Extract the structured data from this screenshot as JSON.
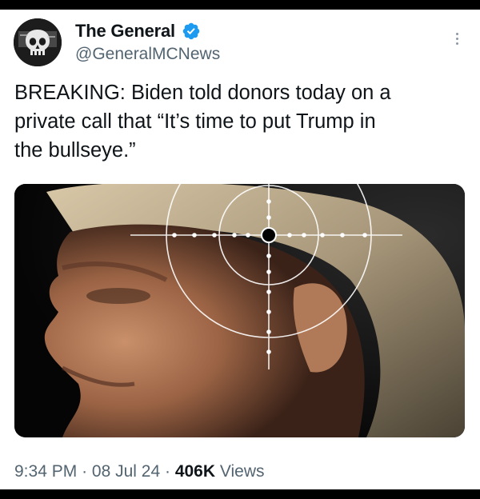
{
  "tweet": {
    "author": {
      "display_name": "The General",
      "handle": "@GeneralMCNews",
      "verified": true,
      "avatar_icon": "skull-emblem-avatar",
      "verified_color": "#1d9bf0"
    },
    "more_icon": "more-options-icon",
    "text": "BREAKING: Biden told donors today on a\nprivate call that “It’s time to put Trump in\nthe bullseye.”",
    "media": {
      "type": "image",
      "subject": "portrait-with-crosshair-overlay"
    },
    "meta": {
      "time": "9:34 PM",
      "separator": "·",
      "date": "08 Jul 24",
      "views_count": "406K",
      "views_label": "Views"
    }
  },
  "colors": {
    "text_primary": "#0f1419",
    "text_secondary": "#536471",
    "background": "#ffffff",
    "frame": "#000000"
  }
}
